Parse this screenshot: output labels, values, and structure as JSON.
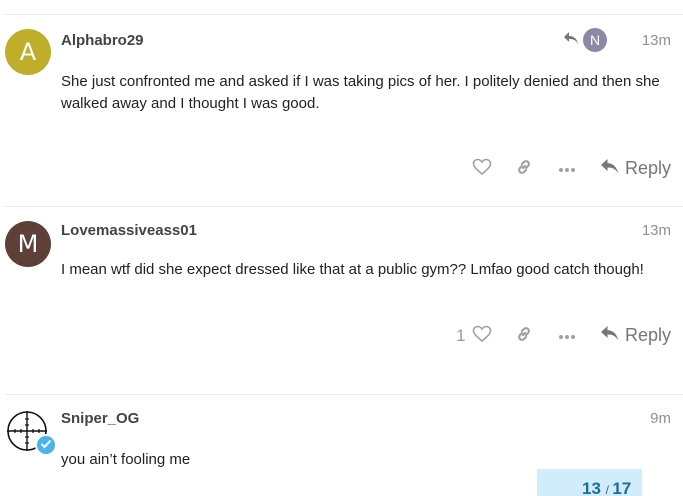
{
  "posts": [
    {
      "avatar_letter": "A",
      "avatar_color": "#bfae2a",
      "username": "Alphabro29",
      "time": "13m",
      "reply_to_avatar": "N",
      "text": "She just confronted me and asked if I was taking pics of her. I politely denied and then she walked away and I thought I was good.",
      "reply_label": "Reply"
    },
    {
      "avatar_letter": "M",
      "avatar_color": "#5e4038",
      "username": "Lovemassiveass01",
      "time": "13m",
      "text": "I mean wtf did she expect dressed like that at a public gym?? Lmfao good catch though!",
      "like_count": "1",
      "reply_label": "Reply"
    },
    {
      "username": "Sniper_OG",
      "time": "9m",
      "text": "you ain’t fooling me"
    }
  ],
  "progress": {
    "current": "13",
    "total": "17",
    "accent": "#1b6da0",
    "bg": "#d1ecfa"
  }
}
